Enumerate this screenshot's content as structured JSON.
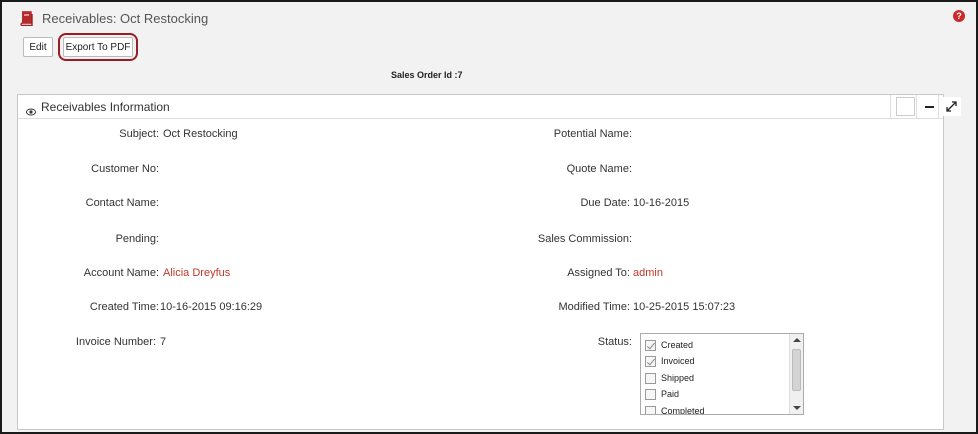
{
  "header": {
    "title": "Receivables: Oct Restocking",
    "help_icon": "?"
  },
  "toolbar": {
    "edit_label": "Edit",
    "export_label": "Export To PDF"
  },
  "sales_order_label": "Sales Order Id :7",
  "panel": {
    "title": "Receivables Information"
  },
  "fields": {
    "subject": {
      "label": "Subject:",
      "value": "Oct Restocking"
    },
    "potential_name": {
      "label": "Potential Name:",
      "value": ""
    },
    "customer_no": {
      "label": "Customer No:",
      "value": ""
    },
    "quote_name": {
      "label": "Quote Name:",
      "value": ""
    },
    "contact_name": {
      "label": "Contact Name:",
      "value": ""
    },
    "due_date": {
      "label": "Due Date:",
      "value": "10-16-2015"
    },
    "pending": {
      "label": "Pending:",
      "value": ""
    },
    "sales_commission": {
      "label": "Sales Commission:",
      "value": ""
    },
    "account_name": {
      "label": "Account Name:",
      "value": "Alicia Dreyfus"
    },
    "assigned_to": {
      "label": "Assigned To:",
      "value": "admin"
    },
    "created_time": {
      "label": "Created Time:",
      "value": "10-16-2015 09:16:29"
    },
    "modified_time": {
      "label": "Modified Time:",
      "value": "10-25-2015 15:07:23"
    },
    "invoice_number": {
      "label": "Invoice Number:",
      "value": "7"
    },
    "status": {
      "label": "Status:"
    }
  },
  "status_options": [
    {
      "label": "Created",
      "checked": true
    },
    {
      "label": "Invoiced",
      "checked": true
    },
    {
      "label": "Shipped",
      "checked": false
    },
    {
      "label": "Paid",
      "checked": false
    },
    {
      "label": "Completed",
      "checked": false
    }
  ],
  "colors": {
    "link": "#c0392b",
    "highlight_ring": "#9b1c24",
    "help": "#cc2b2b"
  }
}
